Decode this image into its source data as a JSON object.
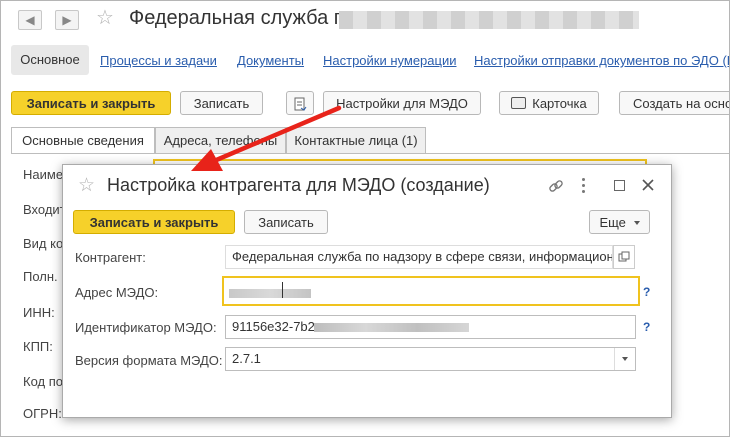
{
  "window": {
    "back_icon": "back-arrow-icon",
    "forward_icon": "forward-arrow-icon",
    "back_glyph": "◀",
    "forward_glyph": "▶",
    "favorite_glyph": "☆",
    "title": "Федеральная служба по"
  },
  "top_nav": {
    "main_label": "Основное",
    "links": [
      "Процессы и задачи",
      "Документы",
      "Настройки нумерации",
      "Настройки отправки документов по ЭДО (П"
    ]
  },
  "toolbar": {
    "save_close": "Записать и закрыть",
    "save": "Записать",
    "medo_settings": "Настройки для МЭДО",
    "card": "Карточка",
    "create_based": "Создать на осно"
  },
  "form_tabs": [
    "Основные сведения",
    "Адреса, телефоны",
    "Контактные лица (1)"
  ],
  "form_labels": [
    "Наиме",
    "Входит",
    "Вид ко",
    "Полн.",
    "ИНН:",
    "КПП:",
    "Код по",
    "ОГРН:"
  ],
  "dialog": {
    "title": "Настройка контрагента для МЭДО (создание)",
    "save_close": "Записать и закрыть",
    "save": "Записать",
    "more": "Еще",
    "counterparty_label": "Контрагент:",
    "counterparty_value": "Федеральная служба по надзору в сфере связи, информационн",
    "address_label": "Адрес МЭДО:",
    "address_value": "",
    "id_label": "Идентификатор МЭДО:",
    "id_value": "91156e32-7b2",
    "format_label": "Версия формата МЭДО:",
    "format_value": "2.7.1",
    "help_mark": "?"
  },
  "colors": {
    "accent_yellow": "#f6d12a",
    "link_blue": "#2a5dad",
    "annotation_red": "#e8231a"
  }
}
